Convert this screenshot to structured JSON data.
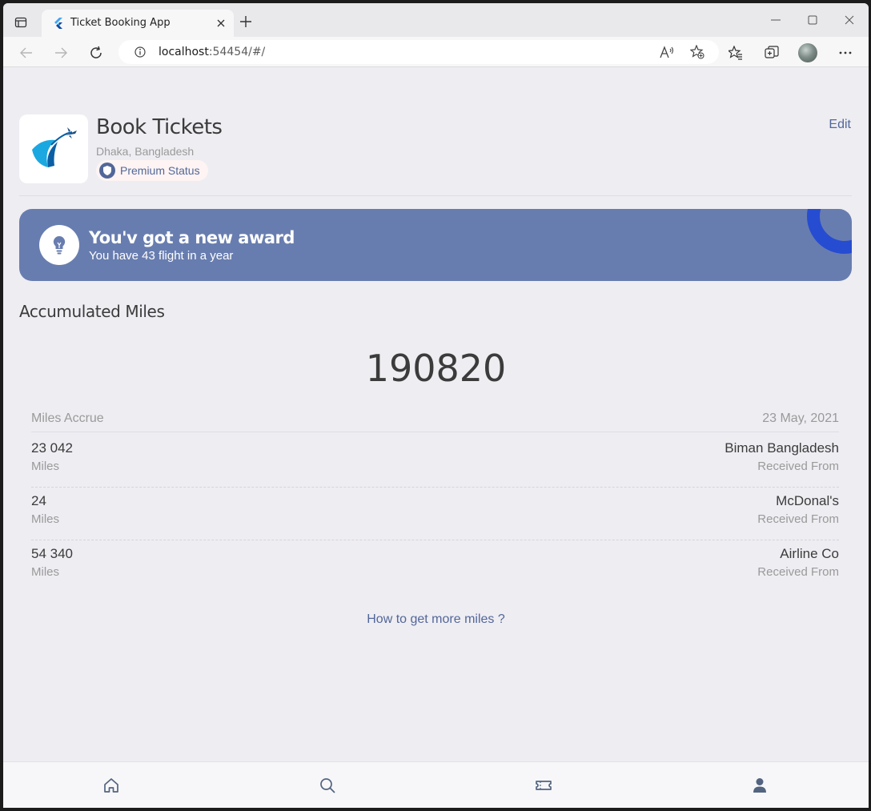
{
  "browser": {
    "tab_title": "Ticket Booking App",
    "url_host": "localhost",
    "url_rest": ":54454/#/"
  },
  "profile": {
    "name": "Book Tickets",
    "location": "Dhaka, Bangladesh",
    "status_label": "Premium Status",
    "edit_label": "Edit"
  },
  "award": {
    "title": "You'v got a new award",
    "subtitle": "You have 43 flight in a year"
  },
  "miles": {
    "section_title": "Accumulated Miles",
    "total": "190820",
    "header_left": "Miles Accrue",
    "header_right": "23 May, 2021",
    "rows": [
      {
        "amount": "23 042",
        "unit": "Miles",
        "source": "Biman Bangladesh",
        "caption": "Received From"
      },
      {
        "amount": "24",
        "unit": "Miles",
        "source": "McDonal's",
        "caption": "Received From"
      },
      {
        "amount": "54 340",
        "unit": "Miles",
        "source": "Airline Co",
        "caption": "Received From"
      }
    ],
    "more_link": "How to get more miles ?"
  },
  "nav": {
    "items": [
      "home-icon",
      "search-icon",
      "ticket-icon",
      "person-icon"
    ],
    "active": "profile"
  },
  "colors": {
    "primary": "#687daf",
    "accent_text": "#526799",
    "ring": "#264cd2",
    "background": "#eeedf2"
  }
}
